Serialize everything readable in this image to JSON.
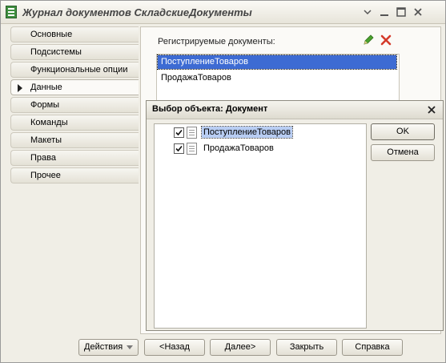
{
  "window": {
    "title": "Журнал документов СкладскиеДокументы"
  },
  "tabs": [
    {
      "label": "Основные",
      "active": false
    },
    {
      "label": "Подсистемы",
      "active": false
    },
    {
      "label": "Функциональные опции",
      "active": false
    },
    {
      "label": "Данные",
      "active": true
    },
    {
      "label": "Формы",
      "active": false
    },
    {
      "label": "Команды",
      "active": false
    },
    {
      "label": "Макеты",
      "active": false
    },
    {
      "label": "Права",
      "active": false
    },
    {
      "label": "Прочее",
      "active": false
    }
  ],
  "panel": {
    "label": "Регистрируемые документы:",
    "documents": [
      "ПоступлениеТоваров",
      "ПродажаТоваров"
    ]
  },
  "dialog": {
    "title": "Выбор объекта: Документ",
    "items": [
      {
        "label": "ПоступлениеТоваров",
        "checked": true
      },
      {
        "label": "ПродажаТоваров",
        "checked": true
      }
    ],
    "ok_label": "OK",
    "cancel_label": "Отмена"
  },
  "footer": {
    "actions_label": "Действия",
    "back_label": "<Назад",
    "next_label": "Далее>",
    "close_label": "Закрыть",
    "help_label": "Справка"
  }
}
